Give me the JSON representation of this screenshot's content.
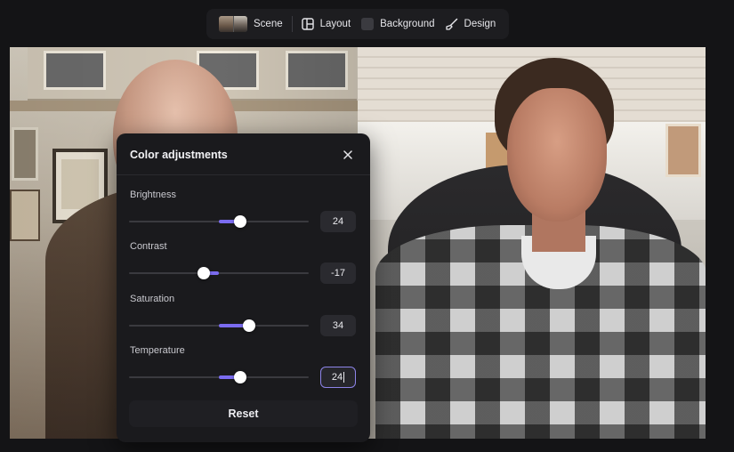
{
  "toolbar": {
    "items": [
      {
        "label": "Scene",
        "icon": "scene-thumbnail"
      },
      {
        "label": "Layout",
        "icon": "layout-icon"
      },
      {
        "label": "Background",
        "icon": "background-swatch"
      },
      {
        "label": "Design",
        "icon": "brush-icon"
      }
    ]
  },
  "panel": {
    "title": "Color adjustments",
    "close_icon": "close-icon",
    "sliders": [
      {
        "label": "Brightness",
        "value": 24,
        "display": "24"
      },
      {
        "label": "Contrast",
        "value": -17,
        "display": "-17"
      },
      {
        "label": "Saturation",
        "value": 34,
        "display": "34"
      },
      {
        "label": "Temperature",
        "value": 24,
        "display": "24",
        "focused": true
      }
    ],
    "slider_range": [
      -100,
      100
    ],
    "reset_label": "Reset"
  },
  "colors": {
    "accent": "#7b6cf0",
    "panel_bg": "#1a1a1d",
    "page_bg": "#141416"
  }
}
